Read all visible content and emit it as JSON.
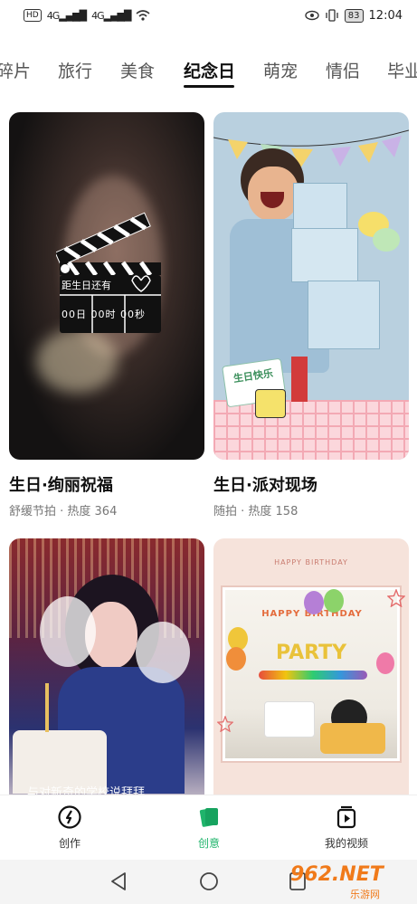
{
  "status_bar": {
    "network_left": "HD",
    "signal1": "4G",
    "signal2": "4G",
    "battery": "83",
    "time": "12:04"
  },
  "tabs": [
    "碎片",
    "旅行",
    "美食",
    "纪念日",
    "萌宠",
    "情侣",
    "毕业"
  ],
  "active_tab": "纪念日",
  "cards": [
    {
      "title": "生日·绚丽祝福",
      "meta": "舒缓节拍 · 热度 364",
      "clapper_line1": "距生日还有",
      "clapper_line2": "00日 00时 00秒"
    },
    {
      "title": "生日·派对现场",
      "meta": "随拍 · 热度 158",
      "sign_text": "生日快乐"
    },
    {
      "title": "",
      "meta": "",
      "overlay_text": "与对新奇的学校说拜拜"
    },
    {
      "title": "",
      "meta": "",
      "header_text": "HAPPY BIRTHDAY",
      "banner_text": "HAPPY BIRTHDAY",
      "party_text": "PARTY"
    }
  ],
  "bottom_nav": [
    {
      "label": "创作",
      "icon": "create-icon"
    },
    {
      "label": "创意",
      "icon": "idea-cards-icon"
    },
    {
      "label": "我的视频",
      "icon": "my-video-icon"
    }
  ],
  "active_nav": "创意",
  "watermark": {
    "brand": "962.NET",
    "sub": "乐游网"
  },
  "colors": {
    "accent": "#1fb46b",
    "text": "#111111",
    "meta": "#777777"
  }
}
